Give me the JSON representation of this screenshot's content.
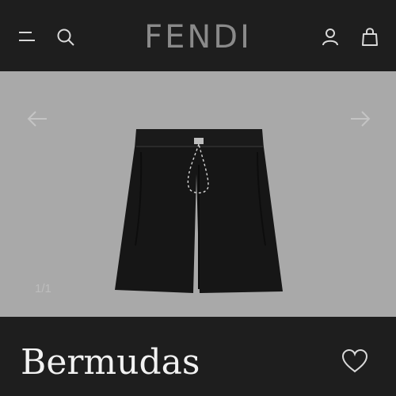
{
  "header": {
    "brand": "FENDI",
    "icons": [
      "menu-icon",
      "search-icon",
      "account-icon",
      "bag-icon"
    ]
  },
  "gallery": {
    "counter": "1/1",
    "prev_icon": "arrow-left-icon",
    "next_icon": "arrow-right-icon"
  },
  "product": {
    "title": "Bermudas",
    "wishlist_icon": "heart-icon"
  },
  "colors": {
    "header_bg": "#1e1e1e",
    "image_bg": "#a9a9a9",
    "brand_text": "#8a8a8a",
    "title_text": "#f2f2f2"
  }
}
